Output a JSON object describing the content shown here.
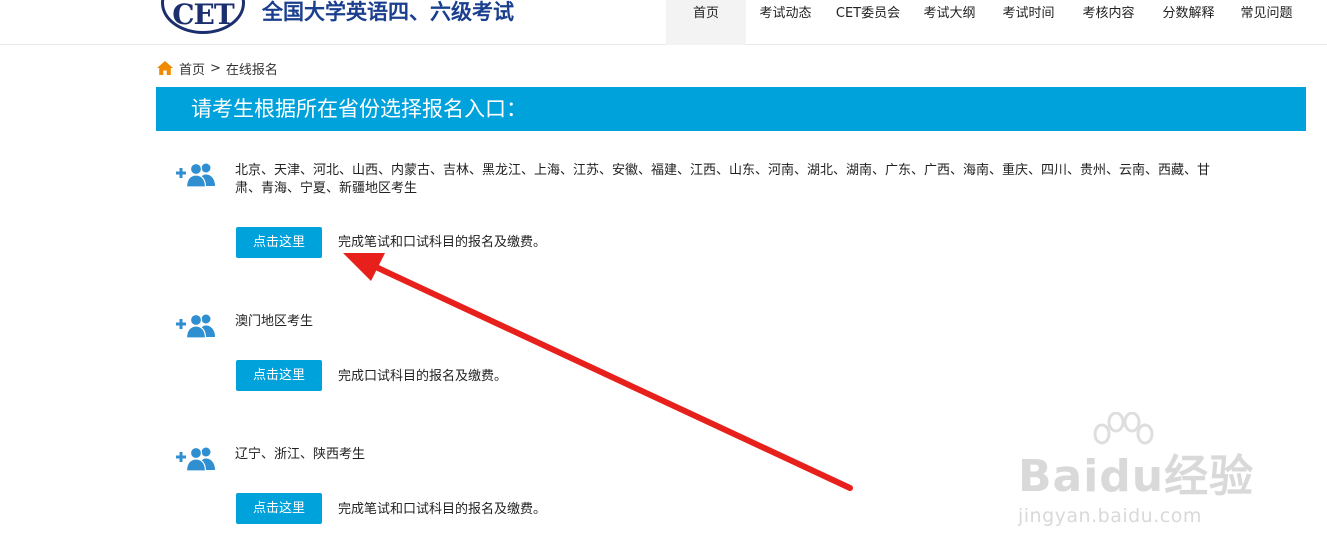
{
  "header": {
    "logo_text": "CET",
    "site_title": "全国大学英语四、六级考试",
    "nav": [
      {
        "label": "首页",
        "active": true
      },
      {
        "label": "考试动态"
      },
      {
        "label": "CET委员会"
      },
      {
        "label": "考试大纲"
      },
      {
        "label": "考试时间"
      },
      {
        "label": "考核内容"
      },
      {
        "label": "分数解释"
      },
      {
        "label": "常见问题"
      }
    ]
  },
  "breadcrumb": {
    "icon": "home-icon",
    "home": "首页",
    "separator": ">",
    "current": "在线报名"
  },
  "banner": {
    "text": "请考生根据所在省份选择报名入口："
  },
  "sections": [
    {
      "icon": "add-user-group-icon",
      "regions": "北京、天津、河北、山西、内蒙古、吉林、黑龙江、上海、江苏、安徽、福建、江西、山东、河南、湖北、湖南、广东、广西、海南、重庆、四川、贵州、云南、西藏、甘肃、青海、宁夏、新疆地区考生",
      "button_label": "点击这里",
      "description": "完成笔试和口试科目的报名及缴费。"
    },
    {
      "icon": "add-user-group-icon",
      "regions": "澳门地区考生",
      "button_label": "点击这里",
      "description": "完成口试科目的报名及缴费。"
    },
    {
      "icon": "add-user-group-icon",
      "regions": "辽宁、浙江、陕西考生",
      "button_label": "点击这里",
      "description": "完成笔试和口试科目的报名及缴费。"
    }
  ],
  "annotation": {
    "type": "red-arrow",
    "color": "#e8201c"
  },
  "watermark": {
    "main": "Baidu经验",
    "sub": "jingyan.baidu.com"
  },
  "colors": {
    "accent": "#00a2dc",
    "title": "#1b3f8f",
    "logo": "#1b2f6e",
    "home_icon": "#f08a00",
    "people_icon": "#2f8fd0"
  }
}
